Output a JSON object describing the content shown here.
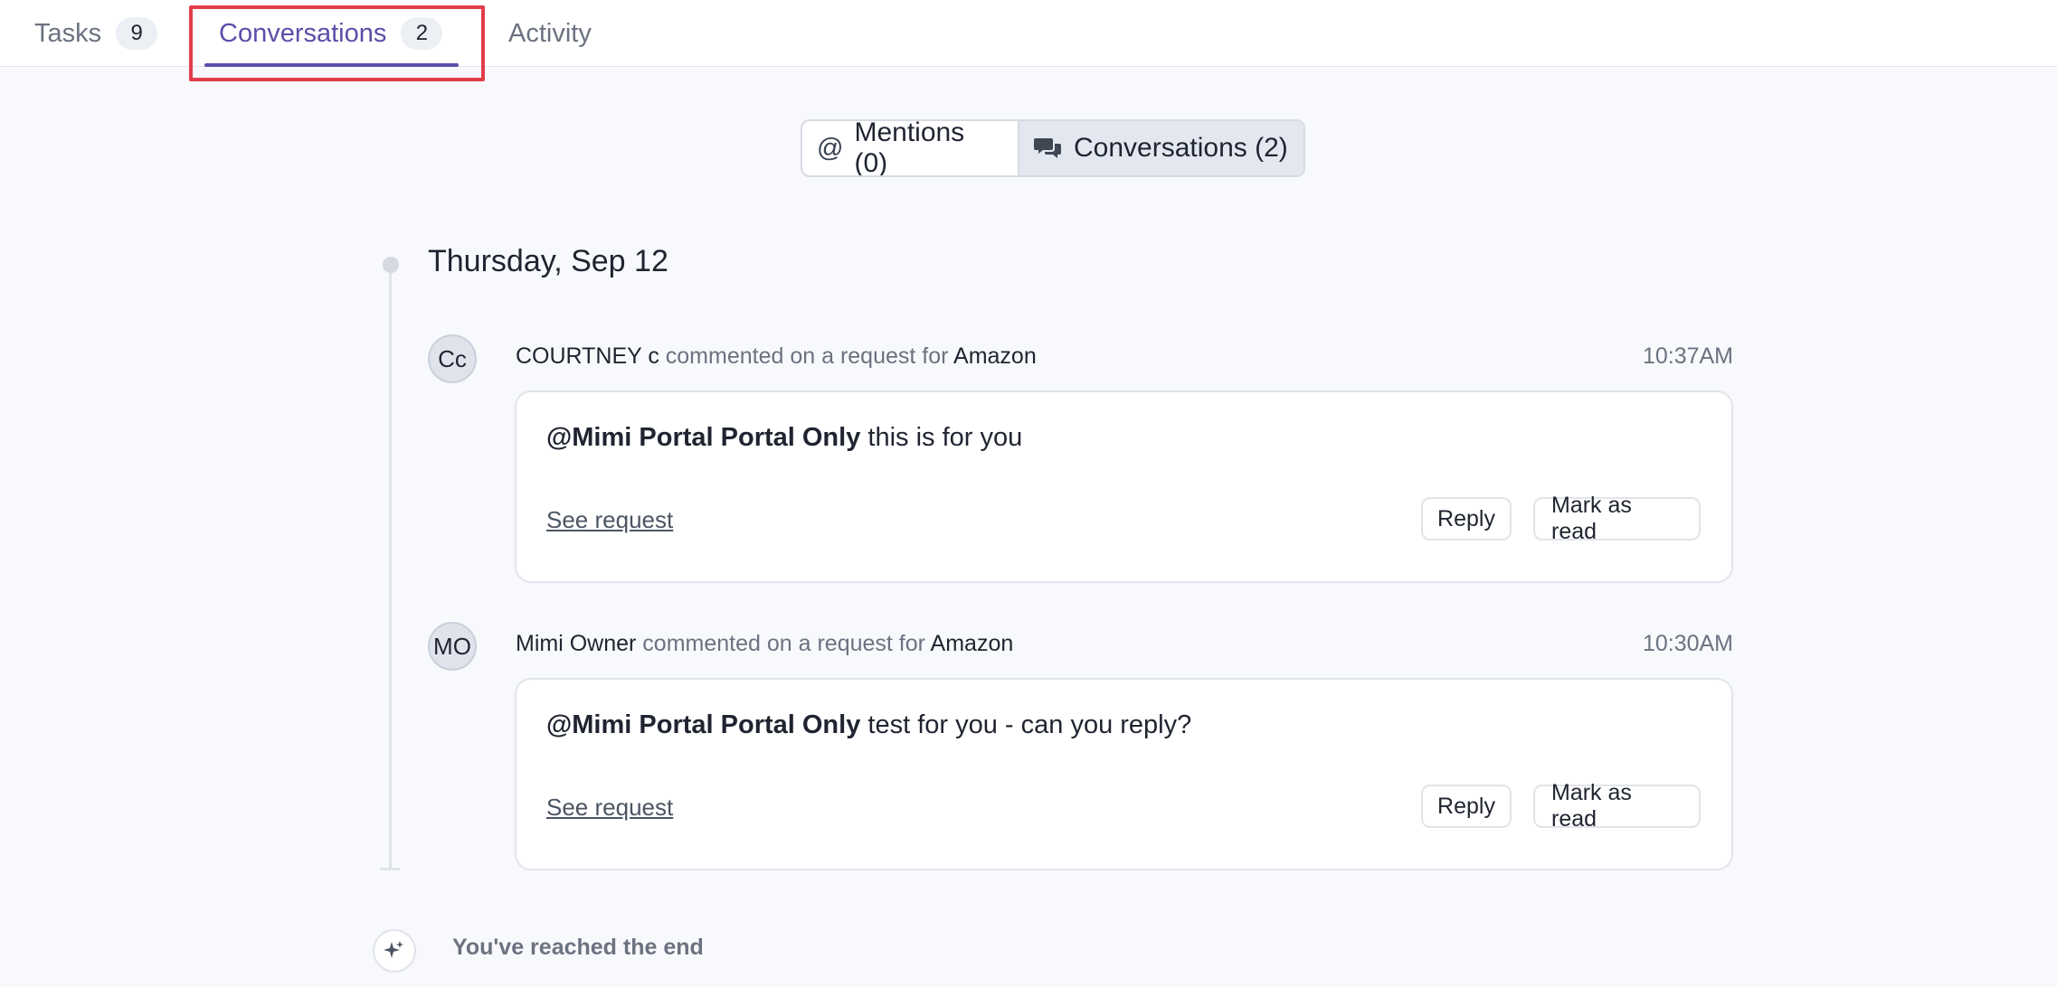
{
  "tabs": {
    "tasks": {
      "label": "Tasks",
      "count": "9"
    },
    "conversations": {
      "label": "Conversations",
      "count": "2"
    },
    "activity": {
      "label": "Activity"
    }
  },
  "filter": {
    "mentions": {
      "symbol": "@",
      "label": "Mentions (0)"
    },
    "conversations": {
      "label": "Conversations (2)",
      "icon": "chat-bubbles-icon"
    }
  },
  "timeline": {
    "date": "Thursday, Sep 12",
    "entries": [
      {
        "avatar": "Cc",
        "author": "COURTNEY c",
        "action": "commented on a request for",
        "org": "Amazon",
        "time": "10:37AM",
        "mention": "@Mimi Portal Portal Only",
        "text": " this is for you",
        "link": "See request",
        "reply": "Reply",
        "mark_read": "Mark as read"
      },
      {
        "avatar": "MO",
        "author": "Mimi Owner",
        "action": "commented on a request for",
        "org": "Amazon",
        "time": "10:30AM",
        "mention": "@Mimi Portal Portal Only",
        "text": " test for you - can you reply?",
        "link": "See request",
        "reply": "Reply",
        "mark_read": "Mark as read"
      }
    ]
  },
  "end_message": "You've reached the end",
  "colors": {
    "accent": "#5a4fa8",
    "highlight": "#e23d4b",
    "background": "#f8f9fc"
  }
}
